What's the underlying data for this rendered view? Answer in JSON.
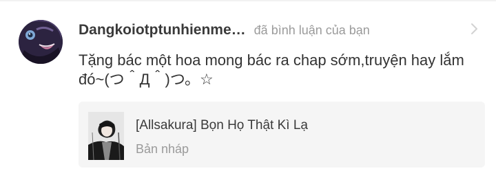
{
  "notification": {
    "username": "Dangkoiotptunhienme…",
    "action": "đã bình luận của bạn",
    "comment": "Tặng bác một hoa mong bác ra chap sớm,truyện hay lắm đó~(つ＾Д＾)つ。☆",
    "avatar_icon": "user-avatar",
    "chevron_icon": "chevron-right-icon"
  },
  "story": {
    "title": "[Allsakura] Bọn Họ Thật Kì Lạ",
    "status": "Bản nháp",
    "cover_icon": "story-cover-image"
  },
  "colors": {
    "username": "#3a3a3a",
    "secondary_text": "#9a9a9a",
    "card_background": "#f5f5f5"
  }
}
